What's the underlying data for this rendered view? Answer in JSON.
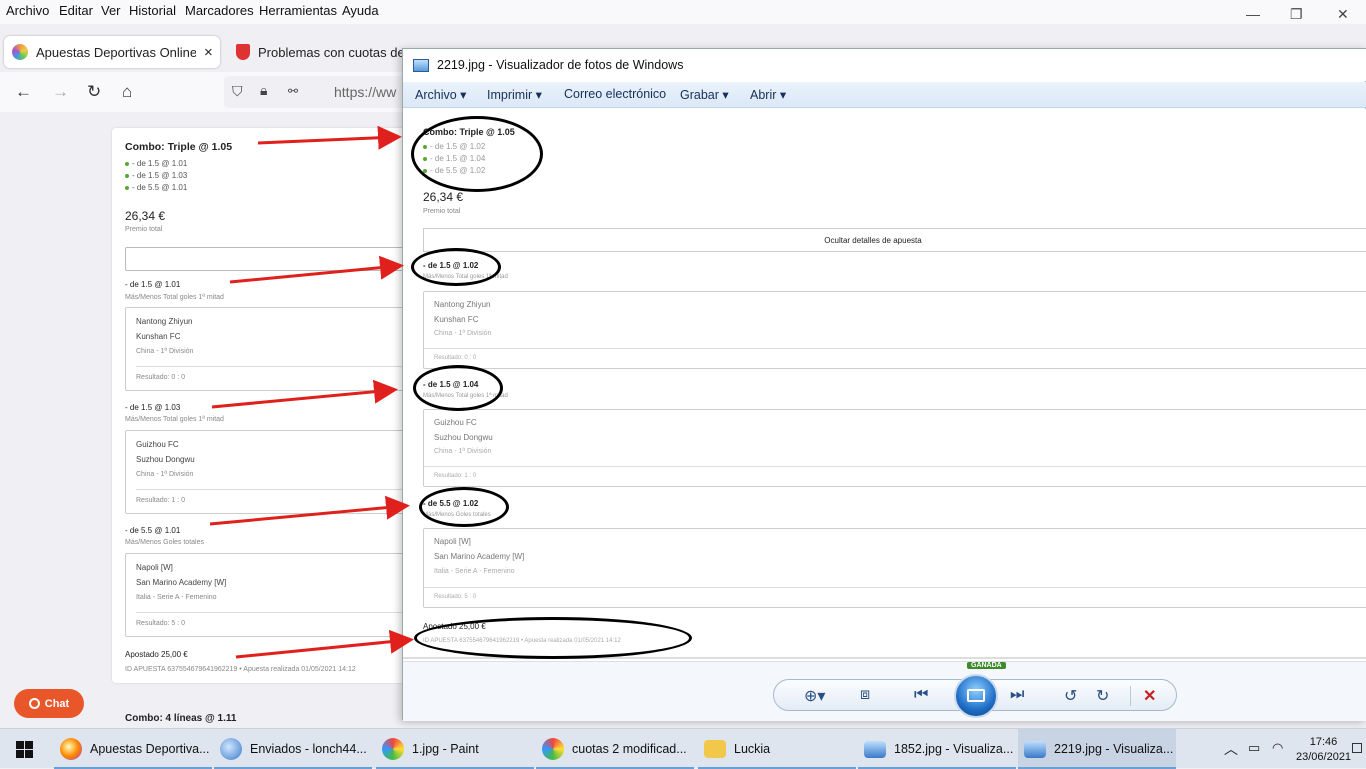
{
  "browser": {
    "menu": [
      "Archivo",
      "Editar",
      "Ver",
      "Historial",
      "Marcadores",
      "Herramientas",
      "Ayuda"
    ],
    "tabs": [
      {
        "label": "Apuestas Deportivas Online | Co"
      },
      {
        "label": "Problemas con cuotas de ap"
      }
    ],
    "tab_close": "×",
    "url": "https://ww",
    "window_controls": {
      "minimize": "—",
      "maximize": "❐",
      "close": "✕"
    }
  },
  "bet_page": {
    "combo_title": "Combo: Triple @ 1.05",
    "legs": [
      "- de 1.5 @ 1.01",
      "- de 1.5 @ 1.03",
      "- de 5.5 @ 1.01"
    ],
    "prize": "26,34 €",
    "prize_label": "Premio total",
    "selections": [
      {
        "name": "- de 1.5 @ 1.01",
        "market": "Más/Menos Total goles 1ª mitad",
        "home": "Nantong Zhiyun",
        "away": "Kunshan FC",
        "league": "China - 1ª División",
        "result": "Resultado: 0 : 0"
      },
      {
        "name": "- de 1.5 @ 1.03",
        "market": "Más/Menos Total goles 1ª mitad",
        "home": "Guizhou FC",
        "away": "Suzhou Dongwu",
        "league": "China - 1ª División",
        "result": "Resultado: 1 : 0"
      },
      {
        "name": "- de 5.5 @ 1.01",
        "market": "Más/Menos Goles totales",
        "home": "Napoli [W]",
        "away": "San Marino Academy [W]",
        "league": "Italia - Serie A - Femenino",
        "result": "Resultado: 5 : 0"
      }
    ],
    "staked": "Apostado 25,00 €",
    "bet_id": "ID APUESTA 637554679641962219 • Apuesta realizada 01/05/2021 14:12",
    "next_combo": "Combo: 4 líneas @ 1.11",
    "chat_label": "Chat"
  },
  "viewer": {
    "title": "2219.jpg - Visualizador de fotos de Windows",
    "menu": [
      "Archivo",
      "Imprimir",
      "Correo electrónico",
      "Grabar",
      "Abrir"
    ],
    "combo_title": "Combo: Triple @ 1.05",
    "legs": [
      "- de 1.5 @ 1.02",
      "- de 1.5 @ 1.04",
      "- de 5.5 @ 1.02"
    ],
    "prize": "26,34 €",
    "prize_label": "Premio total",
    "hide_details": "Ocultar detalles de apuesta",
    "selections": [
      {
        "name": "- de 1.5 @ 1.02",
        "market": "Más/Menos Total goles 1ª mitad",
        "home": "Nantong Zhiyun",
        "away": "Kunshan FC",
        "league": "China - 1ª División",
        "result": "Resultado: 0 : 0"
      },
      {
        "name": "- de 1.5 @ 1.04",
        "market": "Más/Menos Total goles 1ª mitad",
        "home": "Guizhou FC",
        "away": "Suzhou Dongwu",
        "league": "China - 1ª División",
        "result": "Resultado: 1 : 0"
      },
      {
        "name": "- de 5.5 @ 1.02",
        "market": "Más/Menos Goles totales",
        "home": "Napoli [W]",
        "away": "San Marino Academy [W]",
        "league": "Italia - Serie A - Femenino",
        "result": "Resultado: 5 : 0"
      }
    ],
    "staked": "Apostado 25,00 €",
    "bet_id": "ID APUESTA 637554679641962219 • Apuesta realizada 01/05/2021 14:12",
    "badge": "GANADA"
  },
  "taskbar": {
    "items": [
      "Apuestas Deportiva...",
      "Enviados - lonch44...",
      "1.jpg - Paint",
      "cuotas 2 modificad...",
      "Luckia",
      "1852.jpg - Visualiza...",
      "2219.jpg - Visualiza..."
    ],
    "time": "17:46",
    "date": "23/06/2021"
  },
  "colors": {
    "accent_orange": "#e8562a",
    "win_green": "#5aa832",
    "viewer_blue": "#1f6fc7",
    "annotation_red": "#e0201c"
  }
}
